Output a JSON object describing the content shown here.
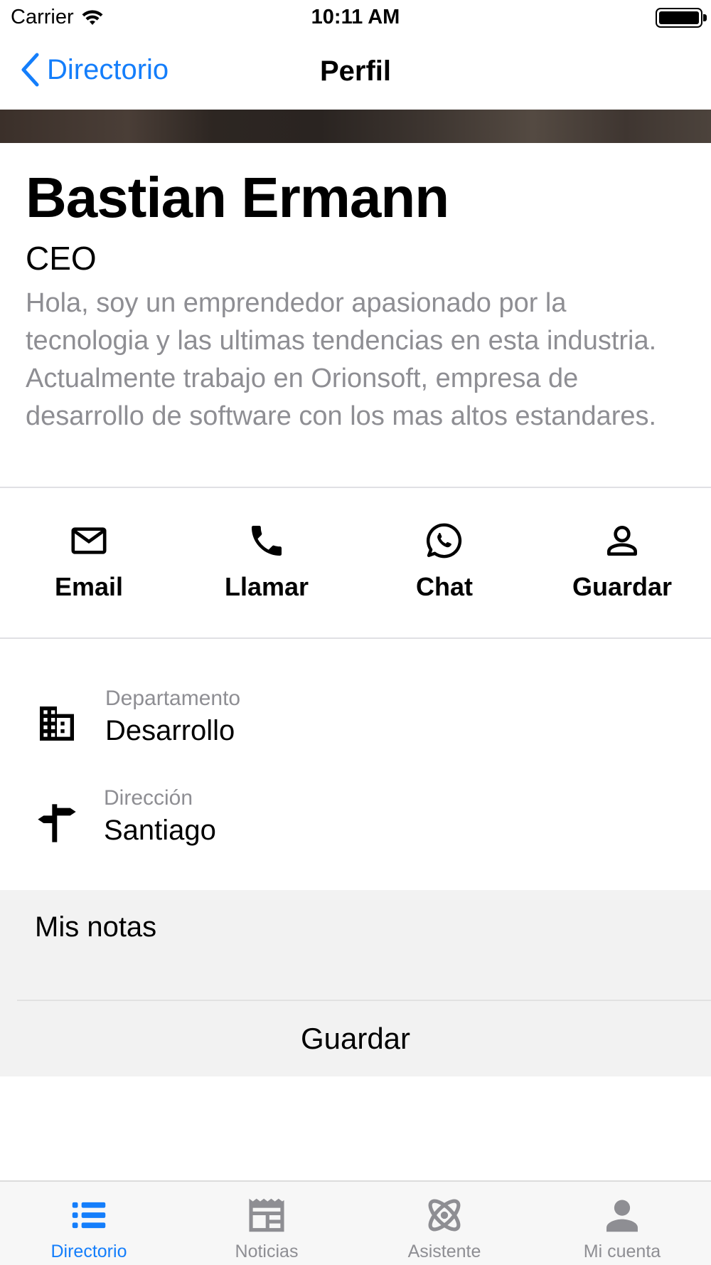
{
  "status_bar": {
    "carrier": "Carrier",
    "time": "10:11 AM"
  },
  "nav": {
    "back_label": "Directorio",
    "title": "Perfil"
  },
  "profile": {
    "name": "Bastian Ermann",
    "role": "CEO",
    "bio": "Hola, soy un emprendedor apasionado por la tecnologia y las ultimas tendencias en esta industria. Actualmente trabajo en Orionsoft, empresa de desarrollo de software con los mas altos estandares."
  },
  "actions": [
    {
      "label": "Email",
      "icon": "mail-icon"
    },
    {
      "label": "Llamar",
      "icon": "phone-icon"
    },
    {
      "label": "Chat",
      "icon": "whatsapp-icon"
    },
    {
      "label": "Guardar",
      "icon": "person-icon"
    }
  ],
  "info": {
    "department": {
      "label": "Departamento",
      "value": "Desarrollo",
      "icon": "building-icon"
    },
    "address": {
      "label": "Dirección",
      "value": "Santiago",
      "icon": "signpost-icon"
    }
  },
  "notes": {
    "title": "Mis notas",
    "save_label": "Guardar"
  },
  "tabs": [
    {
      "label": "Directorio",
      "icon": "list-icon",
      "active": true
    },
    {
      "label": "Noticias",
      "icon": "newspaper-icon",
      "active": false
    },
    {
      "label": "Asistente",
      "icon": "atom-icon",
      "active": false
    },
    {
      "label": "Mi cuenta",
      "icon": "account-icon",
      "active": false
    }
  ],
  "colors": {
    "accent": "#147EFB",
    "secondary_text": "#8e8e93",
    "notes_background": "#f2f2f2"
  }
}
